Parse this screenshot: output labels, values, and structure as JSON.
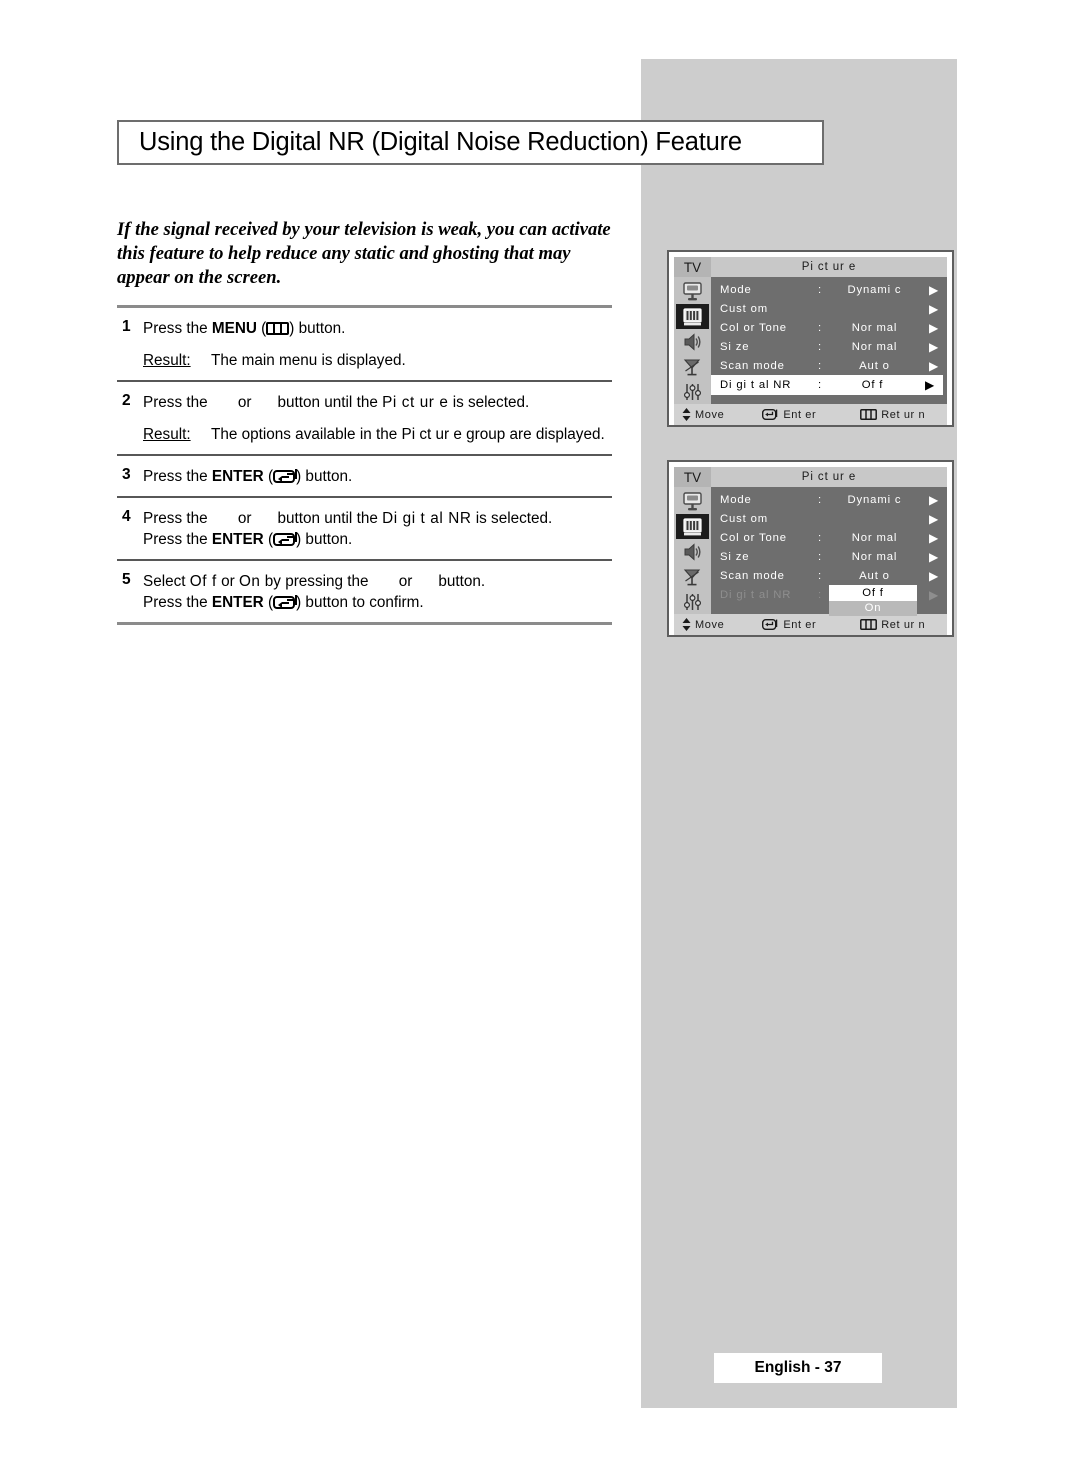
{
  "title": "Using the Digital NR (Digital Noise Reduction) Feature",
  "intro": "If the signal received by your television is weak, you can activate this feature to help reduce any static and ghosting that may appear on the screen.",
  "steps": {
    "s1": {
      "num": "1",
      "pre": "Press the ",
      "bold": "MENU",
      "paren_open": "(",
      "paren_close": ")",
      "post": " button.",
      "result_label": "Result:",
      "result_text": "The main menu is displayed."
    },
    "s2": {
      "num": "2",
      "t_pre": "Press the ",
      "t_or": "or",
      "t_mid": "button until the ",
      "t_item": "Pi ct ur e",
      "t_post": " is selected.",
      "result_label": "Result:",
      "result_text": "The options available in the Pi ct ur e group are displayed."
    },
    "s3": {
      "num": "3",
      "pre": "Press the ",
      "bold": "ENTER",
      "paren_open": "(",
      "paren_close": ")",
      "post": " button."
    },
    "s4": {
      "num": "4",
      "t_pre": "Press the ",
      "t_or": "or",
      "t_mid": "button until the ",
      "t_item": "Di gi t al  NR",
      "t_post": " is selected.",
      "l2_pre": "Press the ",
      "l2_bold": "ENTER",
      "l2_post": " button."
    },
    "s5": {
      "num": "5",
      "t_pre": "Select ",
      "t_off": "Of f",
      "t_or1": " or ",
      "t_on": "On",
      "t_mid": " by pressing the ",
      "t_or2": "or",
      "t_post": "button.",
      "l2_pre": "Press the ",
      "l2_bold": "ENTER",
      "l2_post": " button to confirm."
    }
  },
  "osd": {
    "tv_tag": "TV",
    "menu_title": "Pi ct ur e",
    "rail_icons": [
      "tv-monitor-icon",
      "picture-bars-icon",
      "speaker-icon",
      "satellite-dish-icon",
      "sliders-icon"
    ],
    "rows": [
      {
        "label": "Mode",
        "colon": ":",
        "value": "Dynami c",
        "arrow": "▶"
      },
      {
        "label": "Cust om",
        "colon": "",
        "value": "",
        "arrow": "▶"
      },
      {
        "label": "Col or  Tone",
        "colon": ":",
        "value": "Nor mal",
        "arrow": "▶"
      },
      {
        "label": "Si ze",
        "colon": ":",
        "value": "Nor mal",
        "arrow": "▶"
      },
      {
        "label": "Scan  mode",
        "colon": ":",
        "value": "Aut o",
        "arrow": "▶"
      }
    ],
    "dnr_label": "Di gi t al  NR",
    "dnr_colon": ":",
    "dnr_value": "Of f",
    "dnr_arrow": "▶",
    "dropdown_options": [
      "Of f",
      "On"
    ],
    "footer": {
      "move": "Move",
      "enter": "Ent er",
      "return": "Ret ur n"
    }
  },
  "page_footer": "English - 37",
  "colors": {
    "panel_grey": "#cdcdcd",
    "osd_list_bg": "#6e6e6e",
    "osd_rail_bg": "#c2c2c2",
    "osd_header_bg": "#c8c8c8",
    "osd_footer_bg": "#d2d2d2",
    "highlight_bg": "#ffffff",
    "dim_text": "#8e8e8e"
  }
}
